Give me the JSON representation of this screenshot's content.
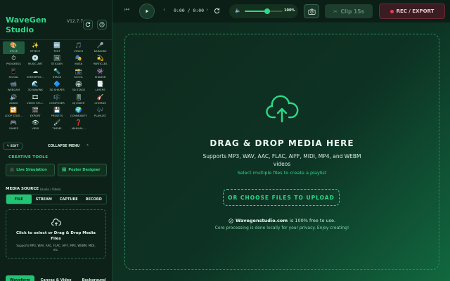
{
  "app": {
    "title": "WaveGen Studio",
    "version": "V12.7.7"
  },
  "sidebar": {
    "modes": [
      {
        "icon": "🎨",
        "label": "STYLE",
        "active": true
      },
      {
        "icon": "✨",
        "label": "EFFECT"
      },
      {
        "icon": "🔤",
        "label": "TEXT"
      },
      {
        "icon": "🎵",
        "label": "LYRICS"
      },
      {
        "icon": "🎤",
        "label": "KARAOKE"
      },
      {
        "icon": "⏱",
        "label": "PROGRESS"
      },
      {
        "icon": "💿",
        "label": "MUSIC ART"
      },
      {
        "icon": "🖼",
        "label": "STICKER"
      },
      {
        "icon": "🎭",
        "label": "MASK"
      },
      {
        "icon": "💫",
        "label": "PARTICLES"
      },
      {
        "icon": "📱",
        "label": "SOCIAL"
      },
      {
        "icon": "☁",
        "label": "ATMOSPHE..."
      },
      {
        "icon": "🔦",
        "label": "STAGE"
      },
      {
        "icon": "📸",
        "label": "SCOOL"
      },
      {
        "icon": "👾",
        "label": "SHADER"
      },
      {
        "icon": "📹",
        "label": "WEBCAM"
      },
      {
        "icon": "🌊",
        "label": "3D WAVINK"
      },
      {
        "icon": "🔷",
        "label": "3D SHAPES"
      },
      {
        "icon": "🏟",
        "label": "3D STAGE"
      },
      {
        "icon": "📑",
        "label": "LAYERS"
      },
      {
        "icon": "🔊",
        "label": "AUDIO"
      },
      {
        "icon": "🎞",
        "label": "VIDEO STU..."
      },
      {
        "icon": "🎼",
        "label": "COMPOSER"
      },
      {
        "icon": "🎚",
        "label": "DJ MIXER"
      },
      {
        "icon": "🎸",
        "label": "CHORDS"
      },
      {
        "icon": "🔁",
        "label": "LOOP STATI..."
      },
      {
        "icon": "🎬",
        "label": "EXPORT"
      },
      {
        "icon": "💾",
        "label": "PRESETS"
      },
      {
        "icon": "🌍",
        "label": "COMMUNITY"
      },
      {
        "icon": "🎶",
        "label": "PLAYLIST"
      },
      {
        "icon": "🎮",
        "label": "GAMES"
      },
      {
        "icon": "👁",
        "label": "VIEW"
      },
      {
        "icon": "🖌",
        "label": "THEME"
      },
      {
        "icon": "❓",
        "label": "MANUAL..."
      }
    ],
    "edit_label": "✎ EDIT",
    "collapse_label": "COLLAPSE MENU",
    "creative_tools": {
      "title": "CREATIVE TOOLS",
      "live_simulation": "Live Simulation",
      "poster_designer": "Poster Designer"
    },
    "media_source": {
      "title": "MEDIA SOURCE",
      "subtitle": "(Audio / Video)",
      "tabs": [
        "FILE",
        "STREAM",
        "CAPTURE",
        "RECORD"
      ],
      "active_tab": "FILE",
      "drop_title": "Click to select or Drag & Drop Media Files",
      "drop_formats": "Supports MP3, WAV, AAC, FLAC, AIFF, MP4, WEBM, MIDI, etc."
    },
    "bottom_tabs": [
      "Waveform",
      "Canvas & Video",
      "Background"
    ]
  },
  "topbar": {
    "time": "0:00 / 0:00",
    "volume_percent": 100,
    "volume_label": "100%",
    "clip_label": "Clip 15s",
    "record_label": "REC / EXPORT"
  },
  "dropzone": {
    "title": "DRAG & DROP MEDIA HERE",
    "subtitle": "Supports MP3, WAV, AAC, FLAC, AIFF, MIDI, MP4, and WEBM videos",
    "multi": "Select multiple files to create a playlist",
    "choose_button": "OR CHOOSE FILES TO UPLOAD",
    "free_site": "Wavegenstudio.com",
    "free_text": "is 100% free to use.",
    "privacy": "Core processing is done locally for your privacy. Enjoy creating!"
  },
  "colors": {
    "accent": "#2fd88a",
    "record": "#e04354",
    "background": "#0b1f17"
  }
}
